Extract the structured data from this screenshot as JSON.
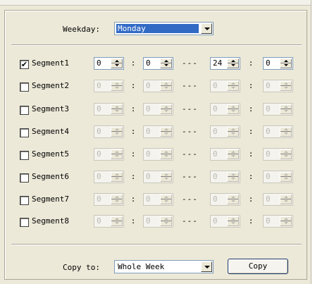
{
  "weekday_label": "Weekday:",
  "weekday_value": "Monday",
  "colon": ":",
  "dash": "---",
  "segments": [
    {
      "label": "Segment1",
      "checked": "✔",
      "start_h": "0",
      "start_m": "0",
      "end_h": "24",
      "end_m": "0",
      "enabled": true
    },
    {
      "label": "Segment2",
      "checked": "",
      "start_h": "0",
      "start_m": "0",
      "end_h": "0",
      "end_m": "0",
      "enabled": false
    },
    {
      "label": "Segment3",
      "checked": "",
      "start_h": "0",
      "start_m": "0",
      "end_h": "0",
      "end_m": "0",
      "enabled": false
    },
    {
      "label": "Segment4",
      "checked": "",
      "start_h": "0",
      "start_m": "0",
      "end_h": "0",
      "end_m": "0",
      "enabled": false
    },
    {
      "label": "Segment5",
      "checked": "",
      "start_h": "0",
      "start_m": "0",
      "end_h": "0",
      "end_m": "0",
      "enabled": false
    },
    {
      "label": "Segment6",
      "checked": "",
      "start_h": "0",
      "start_m": "0",
      "end_h": "0",
      "end_m": "0",
      "enabled": false
    },
    {
      "label": "Segment7",
      "checked": "",
      "start_h": "0",
      "start_m": "0",
      "end_h": "0",
      "end_m": "0",
      "enabled": false
    },
    {
      "label": "Segment8",
      "checked": "",
      "start_h": "0",
      "start_m": "0",
      "end_h": "0",
      "end_m": "0",
      "enabled": false
    }
  ],
  "copy_label": "Copy to:",
  "copy_value": "Whole Week",
  "copy_button": "Copy",
  "colors": {
    "selection": "#316ac5",
    "face": "#ece9d8",
    "border": "#7f9db9"
  }
}
